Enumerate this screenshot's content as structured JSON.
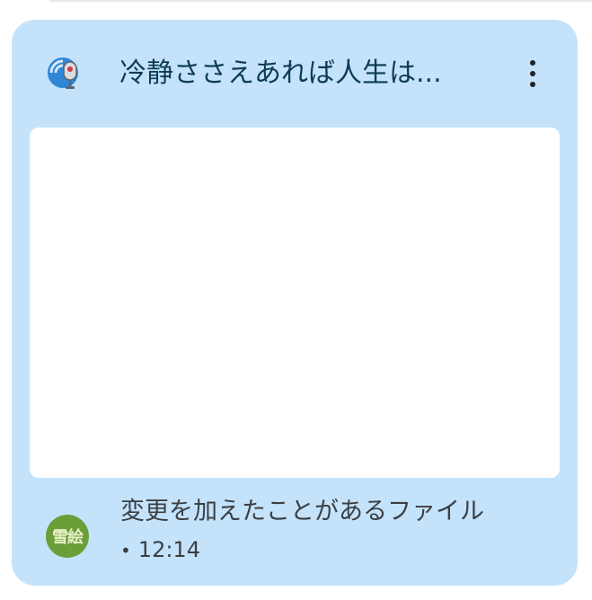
{
  "card": {
    "title": "冷静ささえあれば人生は...",
    "app_icon": "podcast-microphone-icon",
    "menu_icon": "more-vertical-icon",
    "colors": {
      "card_background": "#c4e3fb",
      "title_text": "#0d3b57",
      "avatar_background": "#6a9e38"
    },
    "footer": {
      "avatar_initials": "雪絵",
      "activity": "変更を加えたことがあるファイル",
      "separator": "•",
      "time": "12:14"
    }
  }
}
